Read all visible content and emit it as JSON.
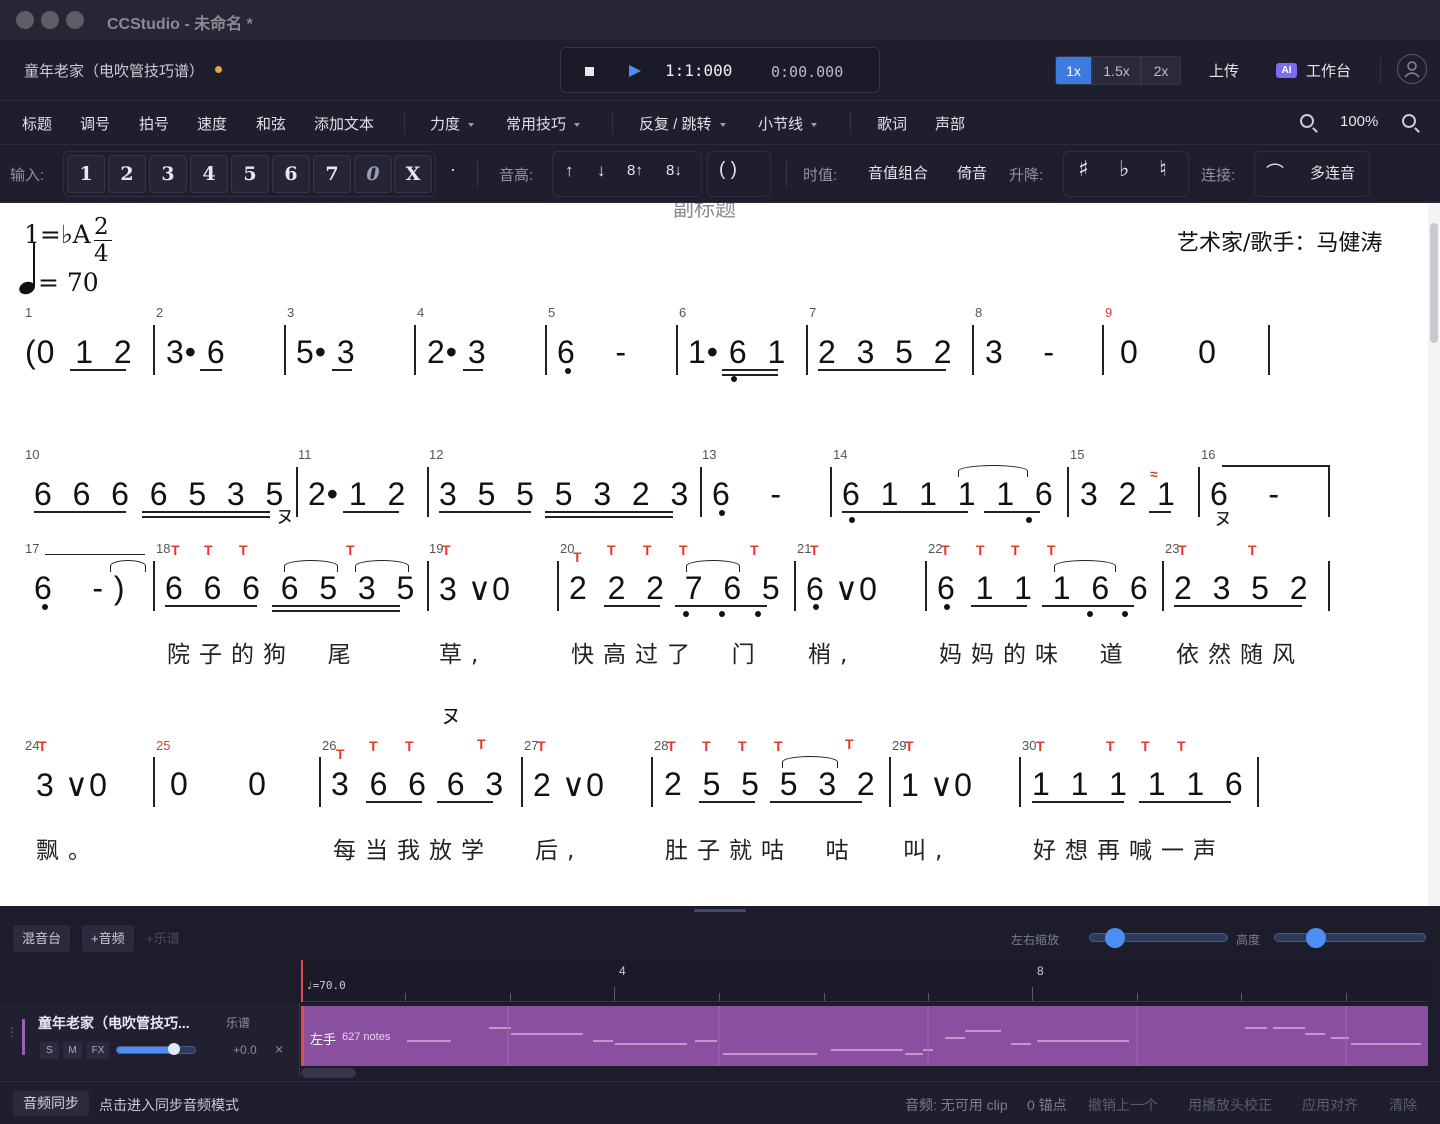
{
  "app": {
    "title": "CCStudio - 未命名 *"
  },
  "header": {
    "doc_title": "童年老家（电吹管技巧谱）",
    "position": "1:1:000",
    "time": "0:00.000",
    "speeds": [
      "1x",
      "1.5x",
      "2x"
    ],
    "active_speed": "1x",
    "upload": "上传",
    "ai_badge": "AI",
    "workbench": "工作台"
  },
  "menubar": {
    "items": [
      "标题",
      "调号",
      "拍号",
      "速度",
      "和弦",
      "添加文本"
    ],
    "dropdowns": [
      "力度",
      "常用技巧",
      "反复 / 跳转",
      "小节线"
    ],
    "items2": [
      "歌词",
      "声部"
    ],
    "zoom": "100%"
  },
  "toolbar": {
    "input_label": "输入:",
    "keys": [
      "1",
      "2",
      "3",
      "4",
      "5",
      "6",
      "7",
      "0",
      "X"
    ],
    "dot_key": "·",
    "pitch_label": "音高:",
    "pitch_keys": [
      "↑",
      "↓",
      "8↑",
      "8↓"
    ],
    "paren_key": "( )",
    "duration_label": "时值:",
    "note_group": "音值组合",
    "grace": "倚音",
    "accidental_label": "升降:",
    "accidentals": [
      "♯",
      "♭",
      "♮"
    ],
    "tie_label": "连接:",
    "tie_icon": "⌒",
    "tuplet": "多连音"
  },
  "score": {
    "subtitle_partial": "副标题",
    "key_sig": "1=♭A",
    "time_sig_top": "2",
    "time_sig_bottom": "4",
    "tempo": "= 70",
    "artist": "艺术家/歌手：马健涛",
    "rows": [
      {
        "measures": [
          "1",
          "2",
          "3",
          "4",
          "5",
          "6",
          "7",
          "8",
          "9"
        ],
        "red_measures": [
          "9"
        ],
        "segments": [
          "(0  1  2",
          "3• 6",
          "5• 3",
          "2• 3",
          "6    -",
          "1• 6  1",
          "2  3  5  2",
          "3    -",
          "0      0"
        ]
      },
      {
        "measures": [
          "10",
          "11",
          "12",
          "13",
          "14",
          "15",
          "16"
        ],
        "segments": [
          "6  6  6  6  5  3  5",
          "2• 1  2",
          "3  5  5  5  3  2  3",
          "6    -",
          "6  1  1  1  1  6",
          "3  2  1",
          "6    -"
        ],
        "marks": [
          "ヌ",
          "ヌ"
        ]
      },
      {
        "measures": [
          "17",
          "18",
          "19",
          "20",
          "21",
          "22",
          "23"
        ],
        "segments": [
          "6    - )",
          "6  6  6  6  5  3  5",
          "3 ∨0",
          "2  2  2  7  6  5",
          "6 ∨0",
          "6  1  1  1  6  6",
          "2  3  5  2"
        ],
        "lyrics": [
          "院子的狗  尾",
          "草,",
          "快高过了  门",
          "梢,",
          "妈妈的味  道",
          "依然随风"
        ]
      },
      {
        "measures": [
          "24",
          "25",
          "26",
          "27",
          "28",
          "29",
          "30"
        ],
        "red_measures": [
          "25"
        ],
        "segments": [
          "3 ∨0",
          "0      0",
          "3  6  6  6  3",
          "2 ∨0",
          "2  5  5  5  3  2",
          "1 ∨0",
          "1  1  1  1  1  6"
        ],
        "lyrics": [
          "飘。",
          "每当我放学",
          "后,",
          "肚子就咕  咕",
          "叫,",
          "好想再喊一声"
        ],
        "marks": [
          "ヌ"
        ]
      }
    ],
    "tech_mark": "T"
  },
  "mixer": {
    "tab_mixer": "混音台",
    "tab_add_audio": "+音频",
    "tab_add_score": "+乐谱",
    "hzoom_label": "左右缩放",
    "height_label": "高度",
    "hzoom_value": 0.13,
    "height_value": 0.24,
    "tempo_marker": "♩=70.0",
    "ruler_labels": [
      "4",
      "8"
    ],
    "track": {
      "name": "童年老家（电吹管技巧...",
      "type": "乐谱",
      "s": "S",
      "m": "M",
      "fx": "FX",
      "volume": 0.78,
      "pan": "+0.0",
      "close": "×",
      "clip_label": "左手",
      "clip_notes": "627 notes"
    }
  },
  "statusbar": {
    "sync": "音频同步",
    "sync_hint": "点击进入同步音频模式",
    "audio_status": "音频: 无可用 clip",
    "anchors": "0 锚点",
    "undo_last": "撤销上一个",
    "playhead_fix": "用播放头校正",
    "apply_align": "应用对齐",
    "clear": "清除"
  },
  "colors": {
    "accent": "#4b8ef5",
    "dirty": "#e8a33c",
    "tech_red": "#e03a2a",
    "clip": "#8a4f9e"
  }
}
